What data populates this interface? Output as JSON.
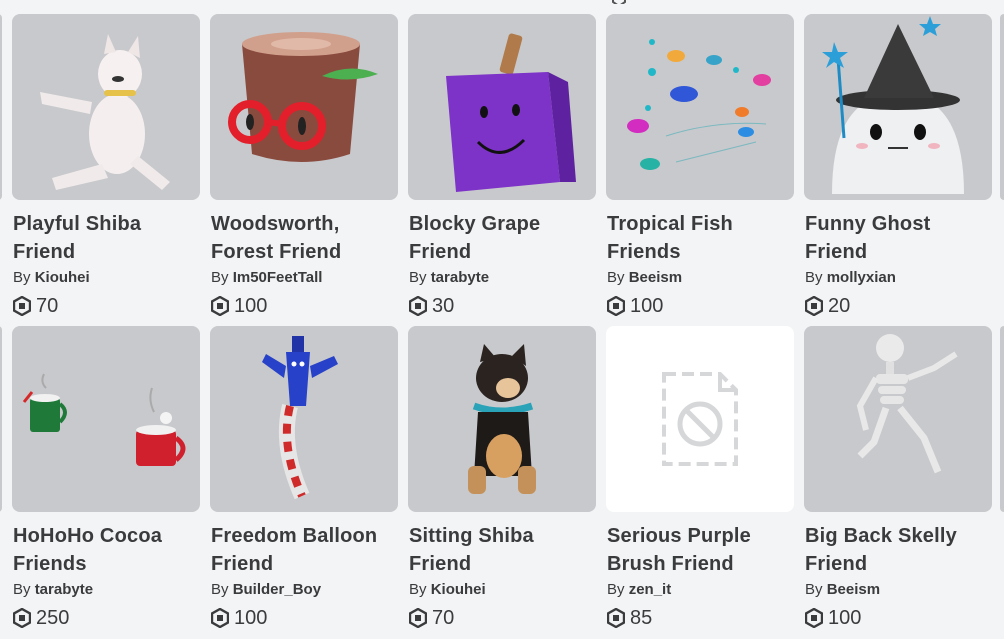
{
  "items": [
    {
      "name": "Playful Shiba Friend",
      "by": "By",
      "creator": "Kiouhei",
      "price": "70",
      "thumb": "shiba-icon"
    },
    {
      "name": "Woodsworth, Forest Friend",
      "by": "By",
      "creator": "Im50FeetTall",
      "price": "100",
      "thumb": "stump-icon"
    },
    {
      "name": "Blocky Grape Friend",
      "by": "By",
      "creator": "tarabyte",
      "price": "30",
      "thumb": "grape-icon"
    },
    {
      "name": "Tropical Fish Friends",
      "by": "By",
      "creator": "Beeism",
      "price": "100",
      "thumb": "fish-icon"
    },
    {
      "name": "Funny Ghost Friend",
      "by": "By",
      "creator": "mollyxian",
      "price": "20",
      "thumb": "ghost-icon"
    },
    {
      "name": "HoHoHo Cocoa Friends",
      "by": "By",
      "creator": "tarabyte",
      "price": "250",
      "thumb": "cocoa-icon"
    },
    {
      "name": "Freedom Balloon Friend",
      "by": "By",
      "creator": "Builder_Boy",
      "price": "100",
      "thumb": "balloon-icon"
    },
    {
      "name": "Sitting Shiba Friend",
      "by": "By",
      "creator": "Kiouhei",
      "price": "70",
      "thumb": "shiba-icon"
    },
    {
      "name": "Serious Purple Brush Friend",
      "by": "By",
      "creator": "zen_it",
      "price": "85",
      "thumb": "unavailable-image-icon"
    },
    {
      "name": "Big Back Skelly Friend",
      "by": "By",
      "creator": "Beeism",
      "price": "100",
      "thumb": "skeleton-icon"
    }
  ],
  "colors": {
    "background": "#f2f4f5",
    "thumb_background": "#c8c9cc",
    "text": "#393b3d"
  },
  "currency_icon": "robux-icon"
}
